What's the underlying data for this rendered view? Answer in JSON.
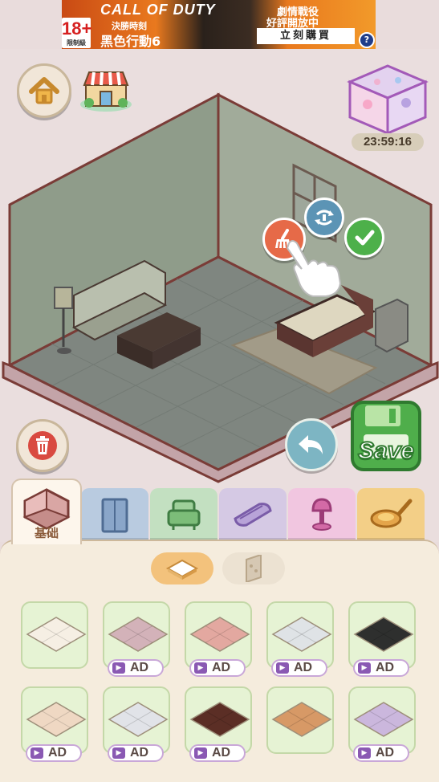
{
  "ad": {
    "age_rating": "18+",
    "age_note": "限制級",
    "brand": "CALL OF DUTY",
    "subtitle": "決勝時刻",
    "title": "黑色行動6",
    "tagline_1": "劇情戰役",
    "tagline_2": "好評開放中",
    "cta": "立刻購買",
    "help": "?"
  },
  "hud": {
    "gift_timer": "23:59:16",
    "save_label": "Save"
  },
  "categories": {
    "active_label": "基础",
    "tabs": [
      {
        "name": "basic",
        "color": "#fdf6ec"
      },
      {
        "name": "cabinet",
        "color": "#b9cbe0"
      },
      {
        "name": "sofa",
        "color": "#c3e0c1"
      },
      {
        "name": "rug",
        "color": "#d5c9e4"
      },
      {
        "name": "lamp",
        "color": "#f1c6e0"
      },
      {
        "name": "kitchen",
        "color": "#f3cf87"
      }
    ]
  },
  "items": {
    "ad_label": "AD",
    "rows": [
      [
        {
          "floor": "#f6efe4",
          "ad": false
        },
        {
          "floor": "#d3b2b9",
          "ad": true
        },
        {
          "floor": "#e3a8a0",
          "ad": true
        },
        {
          "floor": "#dfe3e6",
          "ad": true
        },
        {
          "floor": "#2e2f2e",
          "ad": true
        }
      ],
      [
        {
          "floor": "#efd8c3",
          "ad": true
        },
        {
          "floor": "#e1e3e8",
          "ad": true
        },
        {
          "floor": "#5b2e25",
          "ad": true
        },
        {
          "floor": "#d79966",
          "ad": false
        },
        {
          "floor": "#cbb7dd",
          "ad": true
        }
      ]
    ]
  }
}
